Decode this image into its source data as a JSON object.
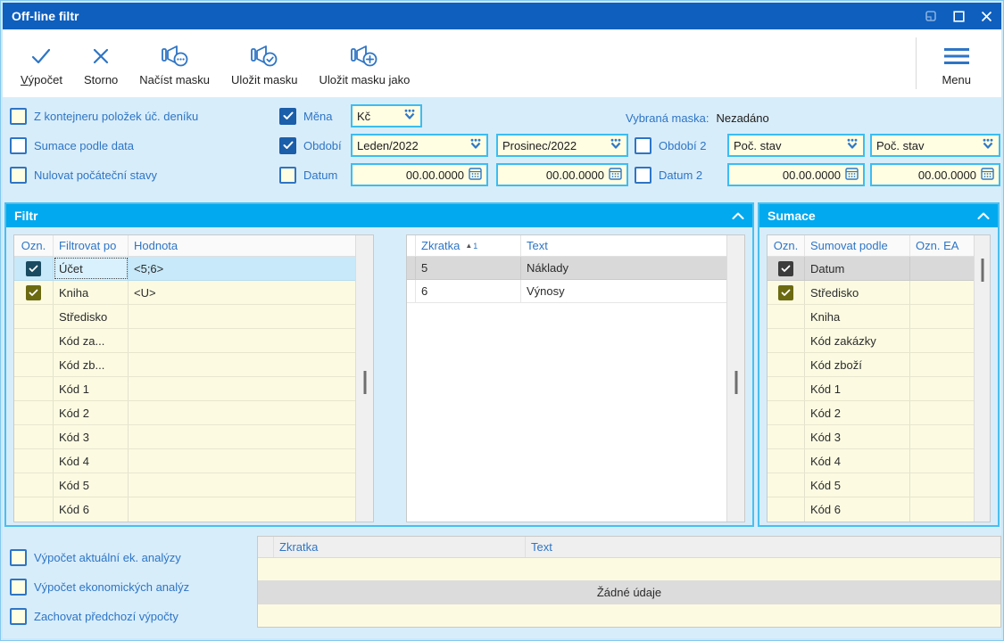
{
  "window": {
    "title": "Off-line filtr",
    "controls": [
      "restore",
      "maximize",
      "close"
    ]
  },
  "colors": {
    "titlebar": "#0E5FBE",
    "panel_header": "#02A9EE",
    "accent_blue": "#2E75C5",
    "field_bg": "#FFFDE2",
    "field_border": "#3BBDF2",
    "row_yellow": "#FCFBE2",
    "selection_blue": "#C7E9FA",
    "selection_gray": "#D9D9D9",
    "checkbox_checked": "#1B5EA9",
    "checkbox_checked_olive": "#6C6A11",
    "checkbox_checked_teal": "#1A4B61"
  },
  "toolbar": {
    "buttons": [
      {
        "label": "Výpočet",
        "icon": "check-icon"
      },
      {
        "label": "Storno",
        "icon": "x-icon"
      },
      {
        "label": "Načíst masku",
        "icon": "mask-ellipsis-icon"
      },
      {
        "label": "Uložit masku",
        "icon": "mask-check-icon"
      },
      {
        "label": "Uložit masku jako",
        "icon": "mask-plus-icon"
      }
    ],
    "menu_label": "Menu"
  },
  "options": {
    "left_checkboxes": [
      {
        "label": "Z kontejneru položek úč. deníku",
        "checked": false
      },
      {
        "label": "Sumace podle data",
        "checked": false
      },
      {
        "label": "Nulovat počáteční stavy",
        "checked": false
      }
    ],
    "mena": {
      "label": "Měna",
      "checked": true,
      "value": "Kč"
    },
    "obdobi": {
      "label": "Období",
      "checked": true,
      "from": "Leden/2022",
      "to": "Prosinec/2022"
    },
    "datum": {
      "label": "Datum",
      "checked": false,
      "from": "00.00.0000",
      "to": "00.00.0000"
    },
    "selected_mask_label": "Vybraná maska:",
    "selected_mask_value": "Nezadáno",
    "obdobi2": {
      "label": "Období 2",
      "checked": false,
      "from": "Poč. stav",
      "to": "Poč. stav"
    },
    "datum2": {
      "label": "Datum 2",
      "checked": false,
      "from": "00.00.0000",
      "to": "00.00.0000"
    }
  },
  "filtr": {
    "title": "Filtr",
    "headers": {
      "ozn": "Ozn.",
      "name": "Filtrovat po",
      "value": "Hodnota"
    },
    "rows": [
      {
        "checked": true,
        "name": "Účet",
        "value": "<5;6>",
        "selected": true
      },
      {
        "checked": true,
        "name": "Kniha",
        "value": "<U>"
      },
      {
        "checked": false,
        "name": "Středisko",
        "value": ""
      },
      {
        "checked": false,
        "name": "Kód za...",
        "value": ""
      },
      {
        "checked": false,
        "name": "Kód zb...",
        "value": ""
      },
      {
        "checked": false,
        "name": "Kód 1",
        "value": ""
      },
      {
        "checked": false,
        "name": "Kód 2",
        "value": ""
      },
      {
        "checked": false,
        "name": "Kód 3",
        "value": ""
      },
      {
        "checked": false,
        "name": "Kód 4",
        "value": ""
      },
      {
        "checked": false,
        "name": "Kód 5",
        "value": ""
      },
      {
        "checked": false,
        "name": "Kód 6",
        "value": ""
      }
    ],
    "detail": {
      "headers": {
        "zkratka": "Zkratka",
        "text": "Text"
      },
      "sort": {
        "column": "Zkratka",
        "direction": "asc",
        "order": "1"
      },
      "rows": [
        {
          "zkratka": "5",
          "text": "Náklady",
          "selected": true
        },
        {
          "zkratka": "6",
          "text": "Výnosy"
        }
      ]
    }
  },
  "sumace": {
    "title": "Sumace",
    "headers": {
      "ozn": "Ozn.",
      "name": "Sumovat podle",
      "ea": "Ozn. EA"
    },
    "rows": [
      {
        "checked": true,
        "name": "Datum",
        "ea": "",
        "selected": true
      },
      {
        "checked": true,
        "name": "Středisko",
        "ea": ""
      },
      {
        "checked": false,
        "name": "Kniha",
        "ea": ""
      },
      {
        "checked": false,
        "name": "Kód zakázky",
        "ea": ""
      },
      {
        "checked": false,
        "name": "Kód zboží",
        "ea": ""
      },
      {
        "checked": false,
        "name": "Kód 1",
        "ea": ""
      },
      {
        "checked": false,
        "name": "Kód 2",
        "ea": ""
      },
      {
        "checked": false,
        "name": "Kód 3",
        "ea": ""
      },
      {
        "checked": false,
        "name": "Kód 4",
        "ea": ""
      },
      {
        "checked": false,
        "name": "Kód 5",
        "ea": ""
      },
      {
        "checked": false,
        "name": "Kód 6",
        "ea": ""
      }
    ]
  },
  "bottom": {
    "checkboxes": [
      {
        "label": "Výpočet aktuální ek. analýzy",
        "checked": false
      },
      {
        "label": "Výpočet ekonomických analýz",
        "checked": false
      },
      {
        "label": "Zachovat předchozí výpočty",
        "checked": false
      }
    ],
    "table": {
      "headers": {
        "zkratka": "Zkratka",
        "text": "Text"
      },
      "empty_message": "Žádné údaje"
    }
  }
}
